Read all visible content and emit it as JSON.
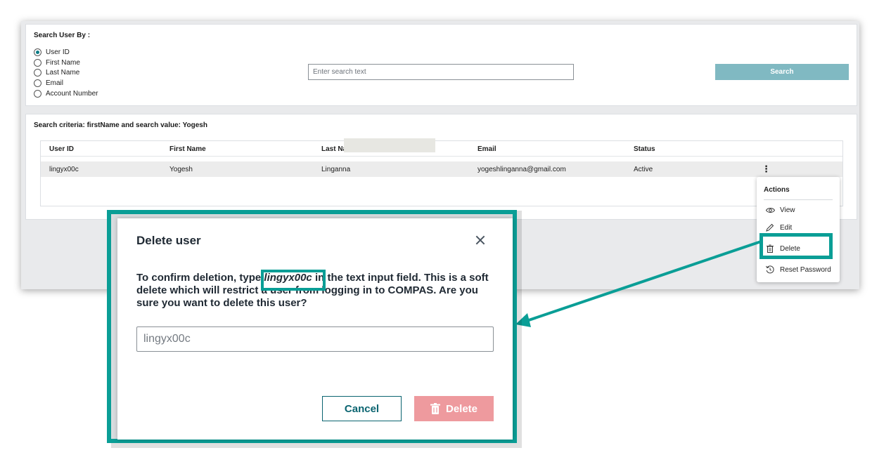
{
  "search": {
    "title": "Search User By :",
    "options": [
      "User ID",
      "First Name",
      "Last Name",
      "Email",
      "Account Number"
    ],
    "selected": "User ID",
    "placeholder": "Enter search text",
    "button_label": "Search"
  },
  "results": {
    "criteria": "Search criteria: firstName and search value: Yogesh",
    "columns": [
      "User ID",
      "First Name",
      "Last Na",
      "Email",
      "Status"
    ],
    "rows": [
      {
        "user_id": "lingyx00c",
        "first_name": "Yogesh",
        "last_name": "Linganna",
        "email": "yogeshlinganna@gmail.com",
        "status": "Active",
        "menu_icon": "⋮"
      }
    ]
  },
  "actions_menu": {
    "title": "Actions",
    "items": [
      {
        "label": "View",
        "icon": "eye-icon"
      },
      {
        "label": "Edit",
        "icon": "pencil-icon"
      },
      {
        "label": "Delete",
        "icon": "trash-icon"
      },
      {
        "label": "Reset Password",
        "icon": "reset-icon"
      }
    ]
  },
  "dialog": {
    "title": "Delete user",
    "message_part1": "To confirm deletion, type ",
    "message_uid": "lingyx00c",
    "message_part2": " in the text input field. This is a soft delete which will restrict a user from logging in to COMPAS. Are you sure you want to delete this user?",
    "input_placeholder": "lingyx00c",
    "cancel_label": "Cancel",
    "delete_label": "Delete"
  },
  "colors": {
    "highlight": "#0a9e96",
    "search_button": "#80b9c2",
    "delete_button_disabled": "#ee9a9e",
    "cancel_border": "#0a6470"
  }
}
